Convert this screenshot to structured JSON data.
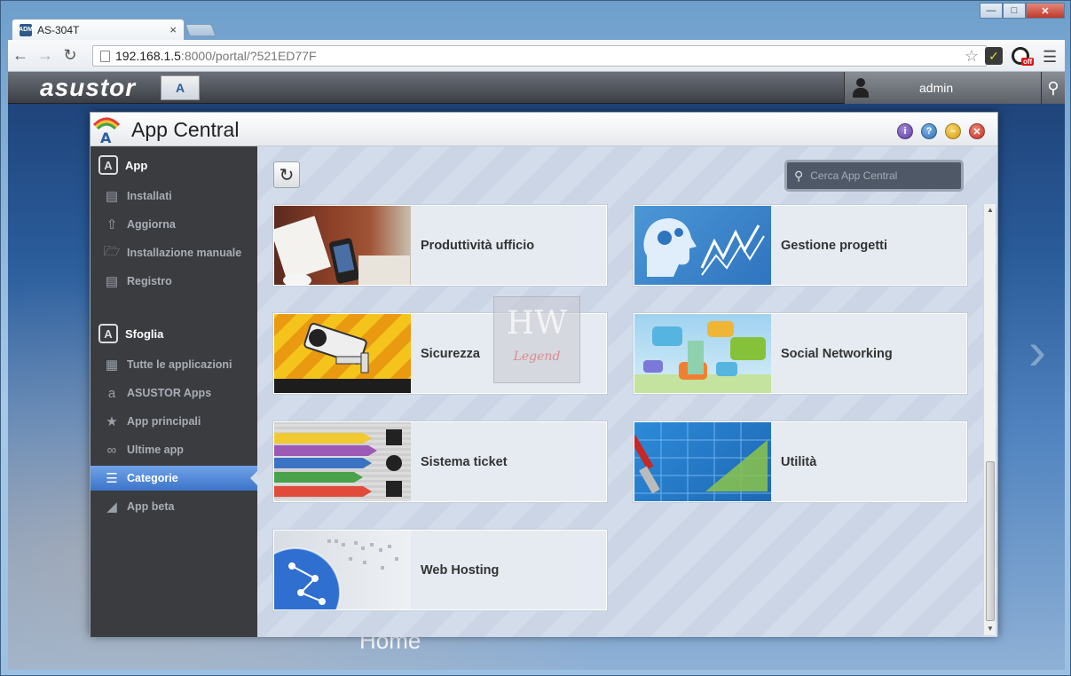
{
  "browser": {
    "tab_title": "AS-304T",
    "tab_close": "×",
    "url_host": "192.168.1.5",
    "url_rest": ":8000/portal/?521ED77F",
    "back_icon": "back-arrow-icon",
    "forward_icon": "forward-arrow-icon",
    "reload_icon": "reload-icon",
    "star_icon": "bookmark-star-icon",
    "menu_icon": "hamburger-menu-icon",
    "ext_badge": "off",
    "window_buttons": [
      "minimize",
      "maximize",
      "close"
    ]
  },
  "adm": {
    "logo_text": "asustor",
    "user_name": "admin"
  },
  "app_central": {
    "title": "App Central",
    "sidebar": {
      "section_app": "App",
      "app_items": [
        {
          "label": "Installati",
          "icon": "installed-icon"
        },
        {
          "label": "Aggiorna",
          "icon": "update-icon"
        },
        {
          "label": "Installazione manuale",
          "icon": "manual-install-icon"
        },
        {
          "label": "Registro",
          "icon": "log-icon"
        }
      ],
      "section_browse": "Sfoglia",
      "browse_items": [
        {
          "label": "Tutte le applicazioni",
          "icon": "grid-icon"
        },
        {
          "label": "ASUSTOR Apps",
          "icon": "asustor-apps-icon"
        },
        {
          "label": "App principali",
          "icon": "star-icon"
        },
        {
          "label": "Ultime app",
          "icon": "latest-apps-icon"
        },
        {
          "label": "Categorie",
          "icon": "list-icon",
          "active": true
        },
        {
          "label": "App beta",
          "icon": "beta-icon"
        }
      ]
    },
    "search_placeholder": "Cerca App Central",
    "categories": [
      {
        "label": "Produttività ufficio"
      },
      {
        "label": "Gestione progetti"
      },
      {
        "label": "Sicurezza"
      },
      {
        "label": "Social Networking"
      },
      {
        "label": "Sistema ticket"
      },
      {
        "label": "Utilità"
      },
      {
        "label": "Web Hosting"
      }
    ]
  },
  "desktop": {
    "home_label": "Home"
  },
  "colors": {
    "active_nav": "#4a82d4",
    "sidebar_bg": "#3a3c40",
    "content_bg": "#d3dcea"
  }
}
